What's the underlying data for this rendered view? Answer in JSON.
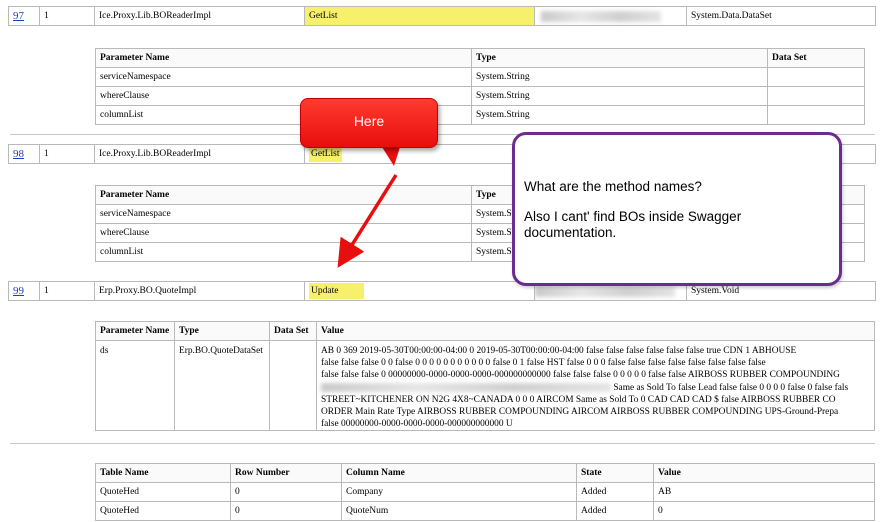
{
  "rows": {
    "r97": {
      "num": "97",
      "count": "1",
      "impl": "Ice.Proxy.Lib.BOReaderImpl",
      "method": "GetList",
      "ret": "System.Data.DataSet"
    },
    "r98": {
      "num": "98",
      "count": "1",
      "impl": "Ice.Proxy.Lib.BOReaderImpl",
      "method": "GetList"
    },
    "r99": {
      "num": "99",
      "count": "1",
      "impl": "Erp.Proxy.BO.QuoteImpl",
      "method": "Update",
      "ret": "System.Void"
    }
  },
  "param_table_1": {
    "headers": [
      "Parameter Name",
      "Type",
      "Data Set"
    ],
    "rows": [
      [
        "serviceNamespace",
        "System.String",
        ""
      ],
      [
        "whereClause",
        "System.String",
        ""
      ],
      [
        "columnList",
        "System.String",
        ""
      ]
    ]
  },
  "param_table_2": {
    "headers": [
      "Parameter Name",
      "Type"
    ],
    "rows": [
      [
        "serviceNamespace",
        "System.S"
      ],
      [
        "whereClause",
        "System.S"
      ],
      [
        "columnList",
        "System.S"
      ]
    ]
  },
  "param_table_3": {
    "headers": [
      "Parameter Name",
      "Type",
      "Data Set",
      "Value"
    ],
    "row": {
      "name": "ds",
      "type": "Erp.BO.QuoteDataSet",
      "value_lines": [
        "AB 0 369 2019-05-30T00:00:00-04:00 0 2019-05-30T00:00:00-04:00 false false false false false false true CDN 1 ABHOUSE",
        "false false false 0 0 false 0 0 0 0 0 0 0 0 0 0 0 false 0 1 false HST false 0 0 0 false false false false false false false false",
        "false false false 0 00000000-0000-0000-0000-000000000000 false false false 0 0 0 0 0 false false AIRBOSS RUBBER COMPOUNDING",
        "Same as Sold To false Lead false false 0 0 0 0 false 0 false fals",
        "STREET~KITCHENER ON N2G 4X8~CANADA 0 0 0 AIRCOM Same as Sold To 0 CAD CAD CAD $ false AIRBOSS RUBBER CO",
        "ORDER Main Rate Type AIRBOSS RUBBER COMPOUNDING AIRCOM AIRBOSS RUBBER COMPOUNDING UPS-Ground-Prepa",
        "false 00000000-0000-0000-0000-000000000000 U"
      ]
    }
  },
  "dataset_table": {
    "headers": [
      "Table Name",
      "Row Number",
      "Column Name",
      "State",
      "Value"
    ],
    "rows": [
      [
        "QuoteHed",
        "0",
        "Company",
        "Added",
        "AB"
      ],
      [
        "QuoteHed",
        "0",
        "QuoteNum",
        "Added",
        "0"
      ]
    ]
  },
  "annotations": {
    "callout_text": "Here",
    "note_line1": "What are the method names?",
    "note_line2": "Also I cant' find BOs inside Swagger documentation."
  },
  "colors": {
    "highlight": "#f7f06a",
    "callout": "#e80e0e",
    "note_border": "#6a2c91",
    "link": "#1a3fbf"
  }
}
